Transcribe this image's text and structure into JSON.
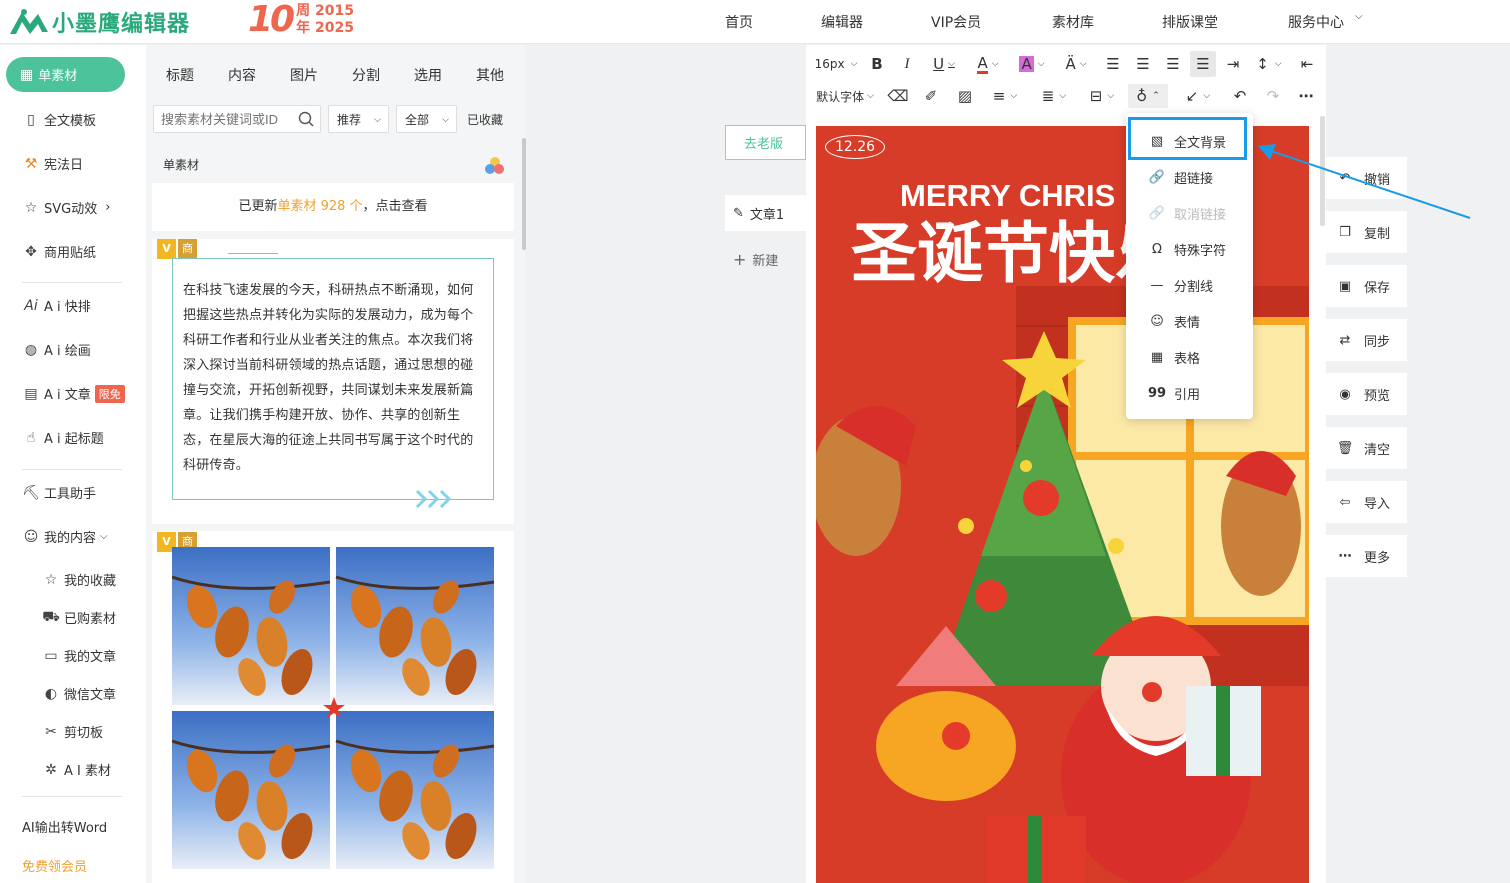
{
  "header": {
    "logo_text": "小墨鹰编辑器",
    "anniversary": {
      "number": "10",
      "line1": "周 2015",
      "line2": "年 2025"
    },
    "nav": [
      "首页",
      "编辑器",
      "VIP会员",
      "素材库",
      "排版课堂",
      "服务中心"
    ]
  },
  "sidebar": {
    "active": "单素材",
    "items": [
      "全文模板",
      "宪法日",
      "SVG动效",
      "商用贴纸",
      "A i 快排",
      "A i 绘画",
      "A i 文章",
      "A i 起标题",
      "工具助手",
      "我的内容"
    ],
    "badge_ai_article": "限免",
    "sub_items": [
      "我的收藏",
      "已购素材",
      "我的文章",
      "微信文章",
      "剪切板",
      "A I 素材"
    ],
    "bottom_link": "AI输出转Word",
    "vip_link": "免费领会员"
  },
  "colors": {
    "brand": "#4cc39a",
    "accent": "#f0654e",
    "highlight": "#1a9be6"
  },
  "material_panel": {
    "tabs": [
      "标题",
      "内容",
      "图片",
      "分割",
      "选用",
      "其他"
    ],
    "search_placeholder": "搜索素材关键词或ID",
    "filter1": "推荐",
    "filter2": "全部",
    "favorites": "已收藏",
    "section_title": "单素材",
    "update_prefix": "已更新",
    "update_link": "单素材 928 个",
    "update_suffix": "，点击查看",
    "tag_v": "V",
    "tag_shop": "商",
    "sample_text": "在科技飞速发展的今天，科研热点不断涌现，如何把握这些热点并转化为实际的发展动力，成为每个科研工作者和行业从业者关注的焦点。本次我们将深入探讨当前科研领域的热点话题，通过思想的碰撞与交流，开拓创新视野，共同谋划未来发展新篇章。让我们携手构建开放、协作、共享的创新生态，在星辰大海的征途上共同书写属于这个时代的科研传奇。"
  },
  "documents": {
    "old_version": "去老版",
    "items": [
      "文章1"
    ],
    "new_doc": "新建"
  },
  "toolbar": {
    "font_size": "16px",
    "font_family": "默认字体"
  },
  "insert_menu": {
    "items": [
      {
        "label": "全文背景",
        "icon": "page-bg-icon",
        "disabled": false
      },
      {
        "label": "超链接",
        "icon": "link-icon",
        "disabled": false
      },
      {
        "label": "取消链接",
        "icon": "unlink-icon",
        "disabled": true
      },
      {
        "label": "特殊字符",
        "icon": "omega-icon",
        "disabled": false
      },
      {
        "label": "分割线",
        "icon": "divider-icon",
        "disabled": false
      },
      {
        "label": "表情",
        "icon": "emoji-icon",
        "disabled": false
      },
      {
        "label": "表格",
        "icon": "table-icon",
        "disabled": false
      },
      {
        "label": "引用",
        "icon": "quote-icon",
        "disabled": false
      }
    ]
  },
  "poster": {
    "date": "12.26",
    "english": "MERRY CHRIS",
    "chinese": "圣诞节快乐"
  },
  "actions": [
    "撤销",
    "复制",
    "保存",
    "同步",
    "预览",
    "清空",
    "导入",
    "更多"
  ]
}
